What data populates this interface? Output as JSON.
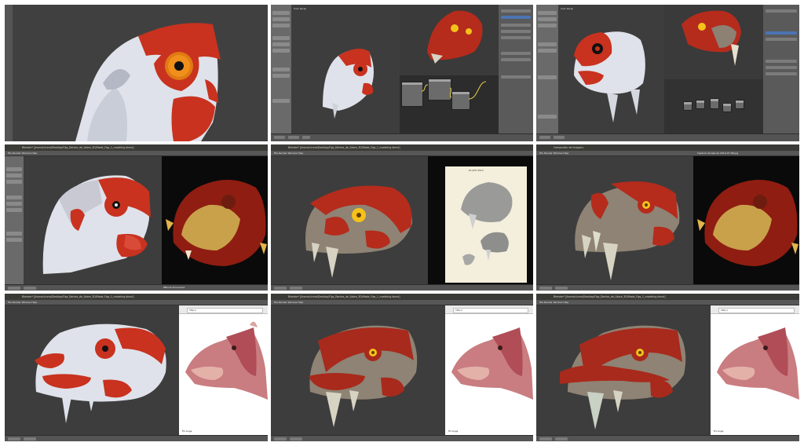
{
  "panels": [
    {
      "id": "p1"
    },
    {
      "id": "p2",
      "viewport_label": "User Persp"
    },
    {
      "id": "p3",
      "viewport_label": "User Persp"
    },
    {
      "id": "p4",
      "title": "Blender* [/home/cicero/Desktop/Figs_Dentes_de_Sabre_3D/Mode_Figs_1_modeling.blend]",
      "menu": "File  Render  Window  Help",
      "status": "Persp · Textured",
      "label": "ZBrush Document"
    },
    {
      "id": "p5",
      "title": "Blender* [/home/cicero/Desktop/Figs_Dentes_de_Sabre_3D/Mode_Figs_1_modeling.blend]",
      "menu": "File  Render  Window  Help",
      "plate_title": "PLATE XXIV"
    },
    {
      "id": "p6",
      "title": "Compositor de Imagens",
      "menu": "File  Render  Window  Help",
      "right_title": "Captura de tela de 2014-07-08.jpg"
    },
    {
      "id": "p7",
      "title": "Blender* [/home/cicero/Desktop/Figs_Dentes_de_Sabre_3D/Mode_Figs_1_modeling.blend]",
      "menu": "File  Render  Window  Help",
      "browser_url": "http://",
      "note": "Fix bugs"
    },
    {
      "id": "p8",
      "title": "Blender* [/home/cicero/Desktop/Figs_Dentes_de_Sabre_3D/Mode_Figs_1_modeling.blend]",
      "menu": "File  Render  Window  Help",
      "browser_url": "http://",
      "note": "Fix bugs"
    },
    {
      "id": "p9",
      "title": "Blender* [/home/cicero/Desktop/Figs_Dentes_de_Sabre_3D/Mode_Figs_1_modeling.blend]",
      "menu": "File  Render  Window  Help",
      "browser_url": "http://",
      "note": "Fix bugs"
    }
  ],
  "colors": {
    "muscle_red": "#c8321f",
    "skull_white": "#e2e4ea",
    "eye_yellow": "#f4c21a",
    "blender_bg": "#3d3d3d"
  }
}
